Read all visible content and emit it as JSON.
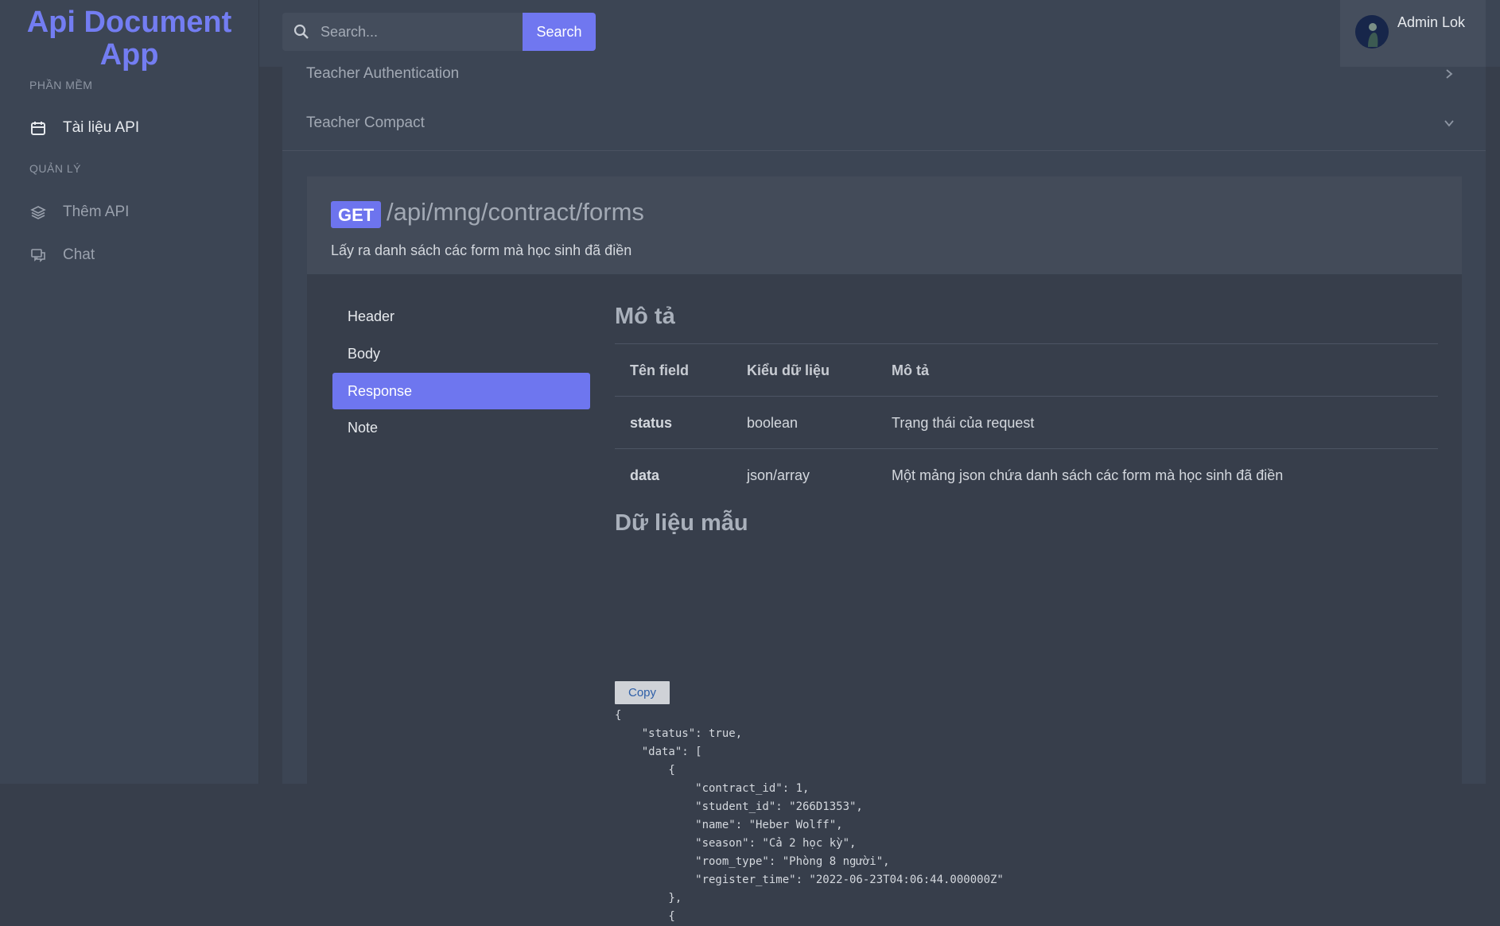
{
  "sidebar": {
    "brand": "Api Document App",
    "section_software": "PHẦN MỀM",
    "item_docs": "Tài liệu API",
    "section_manage": "QUẢN LÝ",
    "item_add_api": "Thêm API",
    "item_chat": "Chat"
  },
  "topbar": {
    "search_placeholder": "Search...",
    "search_button": "Search",
    "user_name": "Admin Lok"
  },
  "accordion": {
    "prev_item": "Teacher Authentication",
    "current_item": "Teacher Compact"
  },
  "endpoint": {
    "method": "GET",
    "path": "/api/mng/contract/forms",
    "description": "Lấy ra danh sách các form mà học sinh đã điền",
    "tabs": [
      {
        "label": "Header"
      },
      {
        "label": "Body"
      },
      {
        "label": "Response"
      },
      {
        "label": "Note"
      }
    ],
    "active_tab": "Response"
  },
  "response": {
    "desc_title": "Mô tả",
    "table_headers": [
      "Tên field",
      "Kiểu dữ liệu",
      "Mô tả"
    ],
    "rows": [
      {
        "field": "status",
        "type": "boolean",
        "desc": "Trạng thái của request"
      },
      {
        "field": "data",
        "type": "json/array",
        "desc": "Một mảng json chứa danh sách các form mà học sinh đã điền"
      }
    ],
    "sample_title": "Dữ liệu mẫu",
    "copy_label": "Copy",
    "sample_code": "{\n    \"status\": true,\n    \"data\": [\n        {\n            \"contract_id\": 1,\n            \"student_id\": \"266D1353\",\n            \"name\": \"Heber Wolff\",\n            \"season\": \"Cả 2 học kỳ\",\n            \"room_type\": \"Phòng 8 người\",\n            \"register_time\": \"2022-06-23T04:06:44.000000Z\"\n        },\n        {"
  },
  "colors": {
    "accent": "#6e76ef",
    "background": "#373e4b",
    "panel": "#3c4554"
  }
}
